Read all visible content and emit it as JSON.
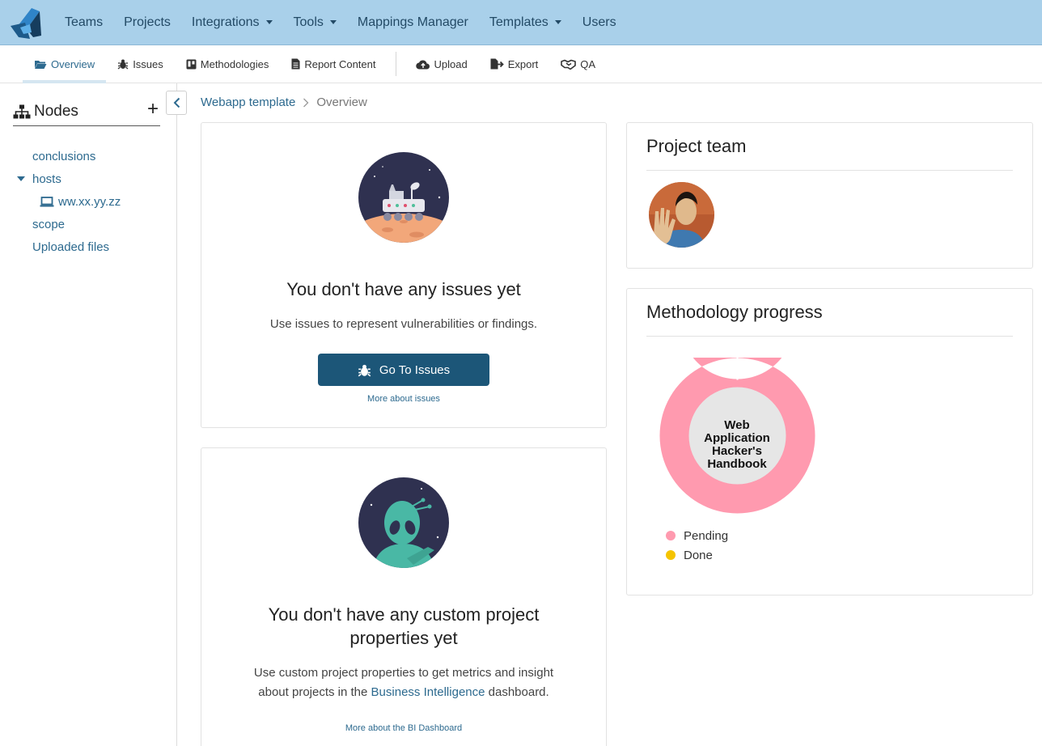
{
  "topnav": {
    "items": [
      {
        "label": "Teams"
      },
      {
        "label": "Projects"
      },
      {
        "label": "Integrations"
      },
      {
        "label": "Tools"
      },
      {
        "label": "Mappings Manager"
      },
      {
        "label": "Templates"
      },
      {
        "label": "Users"
      }
    ]
  },
  "subnav": {
    "items": [
      {
        "label": "Overview",
        "icon": "folder-open-icon"
      },
      {
        "label": "Issues",
        "icon": "bug-icon"
      },
      {
        "label": "Methodologies",
        "icon": "board-icon"
      },
      {
        "label": "Report Content",
        "icon": "document-icon"
      },
      {
        "label": "Upload",
        "icon": "cloud-upload-icon"
      },
      {
        "label": "Export",
        "icon": "export-icon"
      },
      {
        "label": "QA",
        "icon": "handshake-icon"
      }
    ]
  },
  "sidebar": {
    "title": "Nodes",
    "add_symbol": "+",
    "nodes": [
      {
        "label": "conclusions"
      },
      {
        "label": "hosts"
      },
      {
        "label": "ww.xx.yy.zz"
      },
      {
        "label": "scope"
      },
      {
        "label": "Uploaded files"
      }
    ]
  },
  "breadcrumb": {
    "project": "Webapp template",
    "current": "Overview"
  },
  "issues_card": {
    "title": "You don't have any issues yet",
    "text": "Use issues to represent vulnerabilities or findings.",
    "button": "Go To Issues",
    "more": "More about issues"
  },
  "props_card": {
    "title_line1": "You don't have any custom project",
    "title_line2": "properties yet",
    "text_line1": "Use custom project properties to get metrics and insight",
    "text_before_link": "about projects in the ",
    "link": "Business Intelligence",
    "text_after_link": " dashboard.",
    "more": "More about the BI Dashboard"
  },
  "team_card": {
    "title": "Project team"
  },
  "methodology_card": {
    "title": "Methodology progress"
  },
  "chart_data": {
    "type": "pie",
    "center_label": [
      "Web",
      "Application",
      "Hacker's",
      "Handbook"
    ],
    "series": [
      {
        "name": "Pending",
        "value": 100,
        "color": "#ff9aaf"
      },
      {
        "name": "Done",
        "value": 0,
        "color": "#f5c400"
      }
    ],
    "legend": "bottom-left"
  },
  "colors": {
    "topnav": "#a9d0ea",
    "accent": "#2d6a8f",
    "button": "#1c5678"
  }
}
